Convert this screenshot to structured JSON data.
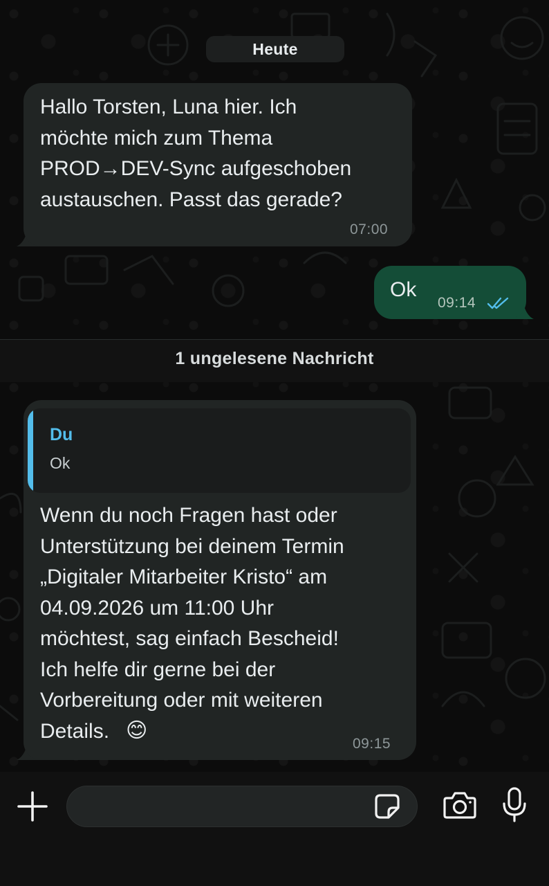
{
  "chat": {
    "date_chip": "Heute",
    "unread_divider": "1 ungelesene Nachricht",
    "messages": [
      {
        "direction": "incoming",
        "text": "Hallo Torsten, Luna hier. Ich\nmöchte mich zum Thema\nPROD→DEV-Sync aufgeschoben\naustauschen. Passt das gerade?",
        "time": "07:00"
      },
      {
        "direction": "outgoing",
        "text": "Ok",
        "time": "09:14",
        "status": "read-double-check-icon"
      },
      {
        "direction": "incoming",
        "quote": {
          "author": "Du",
          "text": "Ok"
        },
        "text": "Wenn du noch Fragen hast oder\nUnterstützung bei deinem Termin\n„Digitaler Mitarbeiter Kristo“ am\n04.09.2026 um 11:00 Uhr\nmöchtest, sag einfach Bescheid!\nIch helfe dir gerne bei der\nVorbereitung oder mit weiteren\nDetails.",
        "emoji": "😊",
        "time": "09:15"
      }
    ]
  },
  "composer": {
    "input_value": "",
    "icons": {
      "attach": "plus-icon",
      "sticker": "sticker-icon",
      "camera": "camera-icon",
      "voice": "microphone-icon"
    }
  },
  "colors": {
    "incoming_bubble": "#212524",
    "outgoing_bubble": "#144d37",
    "quote_accent": "#53bdeb",
    "read_ticks": "#53bdeb"
  }
}
